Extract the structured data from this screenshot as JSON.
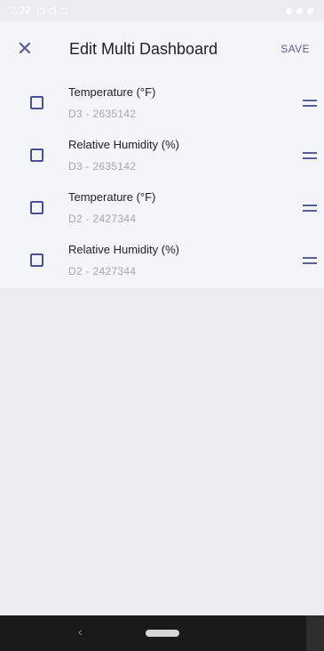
{
  "status_bar": {
    "time": "2:22"
  },
  "header": {
    "title": "Edit Multi Dashboard",
    "save_label": "SAVE"
  },
  "rows": [
    {
      "label": "Temperature (°F)",
      "device": "D3 - 2635142",
      "checked": false
    },
    {
      "label": "Relative Humidity (%)",
      "device": "D3 - 2635142",
      "checked": false
    },
    {
      "label": "Temperature (°F)",
      "device": "D2 - 2427344",
      "checked": false
    },
    {
      "label": "Relative Humidity (%)",
      "device": "D2 - 2427344",
      "checked": false
    }
  ],
  "nav": {
    "back_glyph": "‹"
  }
}
